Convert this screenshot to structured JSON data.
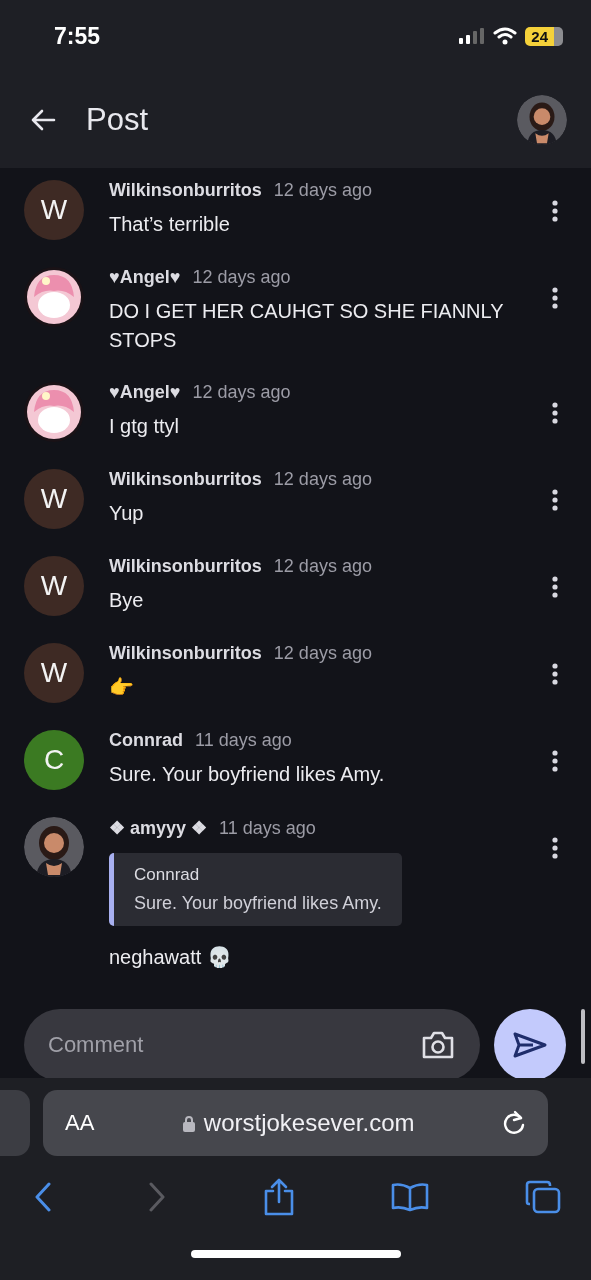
{
  "status_bar": {
    "time": "7:55",
    "battery": "24"
  },
  "app_bar": {
    "title": "Post"
  },
  "comments": [
    {
      "author": "Wilkinsonburritos",
      "time": "12 days ago",
      "text": "That’s terrible",
      "avatar": {
        "kind": "letter",
        "letter": "W",
        "color": "#3e2a24"
      }
    },
    {
      "author": "♥Angel♥",
      "time": "12 days ago",
      "text": "DO I GET HER CAUHGT SO SHE FIANNLY STOPS"
    },
    {
      "author": "♥Angel♥",
      "time": "12 days ago",
      "text": "I gtg ttyl"
    },
    {
      "author": "Wilkinsonburritos",
      "time": "12 days ago",
      "text": "Yup",
      "avatar": {
        "kind": "letter",
        "letter": "W",
        "color": "#3e2a24"
      }
    },
    {
      "author": "Wilkinsonburritos",
      "time": "12 days ago",
      "text": "Bye",
      "avatar": {
        "kind": "letter",
        "letter": "W",
        "color": "#3e2a24"
      }
    },
    {
      "author": "Wilkinsonburritos",
      "time": "12 days ago",
      "text": "👉",
      "avatar": {
        "kind": "letter",
        "letter": "W",
        "color": "#3e2a24"
      }
    },
    {
      "author": "Connrad",
      "time": "11 days ago",
      "text": "Sure. Your boyfriend likes Amy.",
      "avatar": {
        "kind": "letter",
        "letter": "C",
        "color": "#3b7a22"
      }
    },
    {
      "author": "❖ amyyy ❖",
      "time": "11 days ago",
      "quote": {
        "author": "Connrad",
        "text": "Sure. Your boyfriend likes Amy."
      },
      "text": "neghawatt 💀"
    }
  ],
  "composer": {
    "placeholder": "Comment"
  },
  "browser": {
    "text_size": "AA",
    "url": "worstjokesever.com"
  }
}
